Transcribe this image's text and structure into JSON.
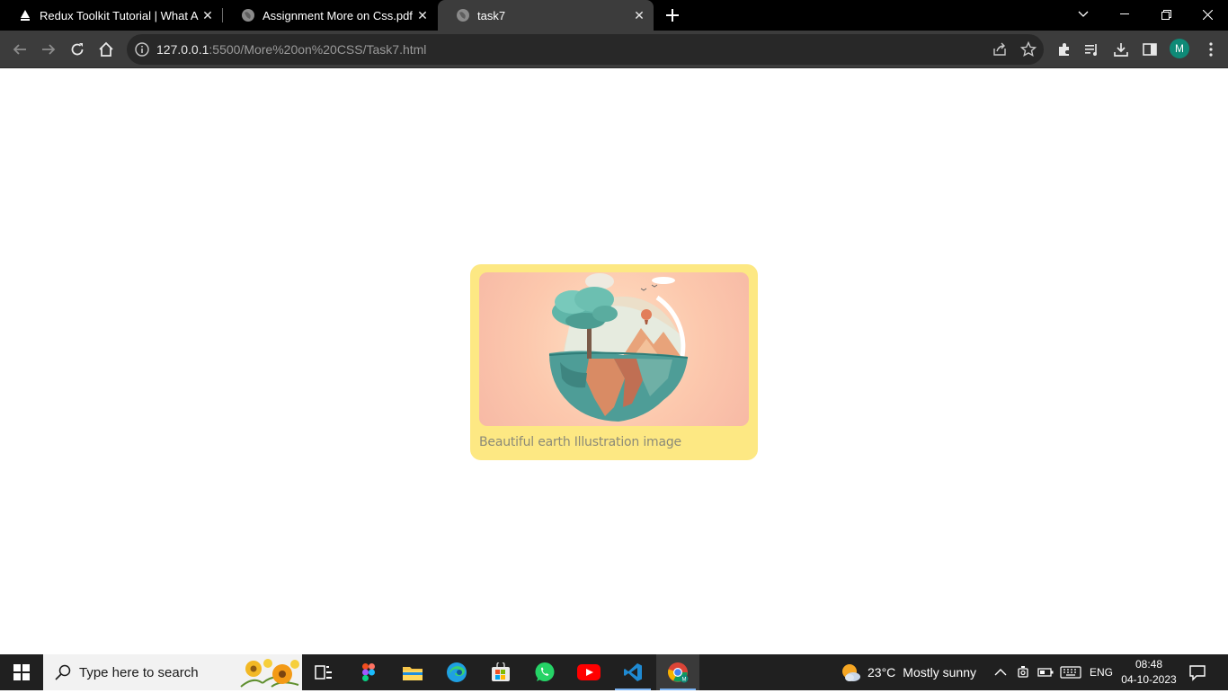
{
  "browser": {
    "tabs": [
      {
        "title": "Redux Toolkit Tutorial | What Ab",
        "favicon": "redux-favicon-icon"
      },
      {
        "title": "Assignment More on Css.pdf",
        "favicon": "globe-icon"
      },
      {
        "title": "task7",
        "favicon": "globe-icon",
        "active": true
      }
    ],
    "address": {
      "host": "127.0.0.1",
      "rest": ":5500/More%20on%20CSS/Task7.html"
    },
    "profile_initial": "M"
  },
  "page": {
    "card": {
      "image_alt": "Beautiful earth Illustration image",
      "caption": "Beautiful earth Illustration image",
      "background_color": "#fde883"
    }
  },
  "taskbar": {
    "search_placeholder": "Type here to search",
    "weather": {
      "temp": "23°C",
      "desc": "Mostly sunny"
    },
    "language": "ENG",
    "time": "08:48",
    "date": "04-10-2023",
    "apps": [
      "task-view-icon",
      "figma-icon",
      "file-explorer-icon",
      "edge-icon",
      "microsoft-store-icon",
      "whatsapp-icon",
      "youtube-icon",
      "vscode-icon",
      "chrome-icon"
    ]
  }
}
